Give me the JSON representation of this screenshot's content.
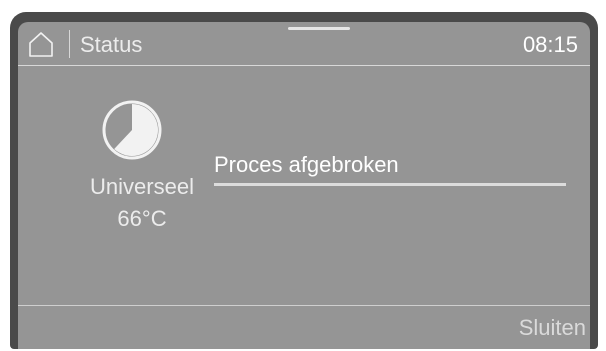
{
  "header": {
    "title": "Status",
    "time": "08:15",
    "home_icon": "home-icon"
  },
  "program": {
    "icon": "pie-progress-icon",
    "name": "Universeel",
    "temperature": "66°C",
    "progress_fraction": 0.62
  },
  "process": {
    "status_text": "Proces afgebroken",
    "bar_fraction": 1.0
  },
  "footer": {
    "close_label": "Sluiten"
  },
  "colors": {
    "screen_bg": "#959595",
    "bezel": "#4a4a4a",
    "text": "#ececec"
  }
}
